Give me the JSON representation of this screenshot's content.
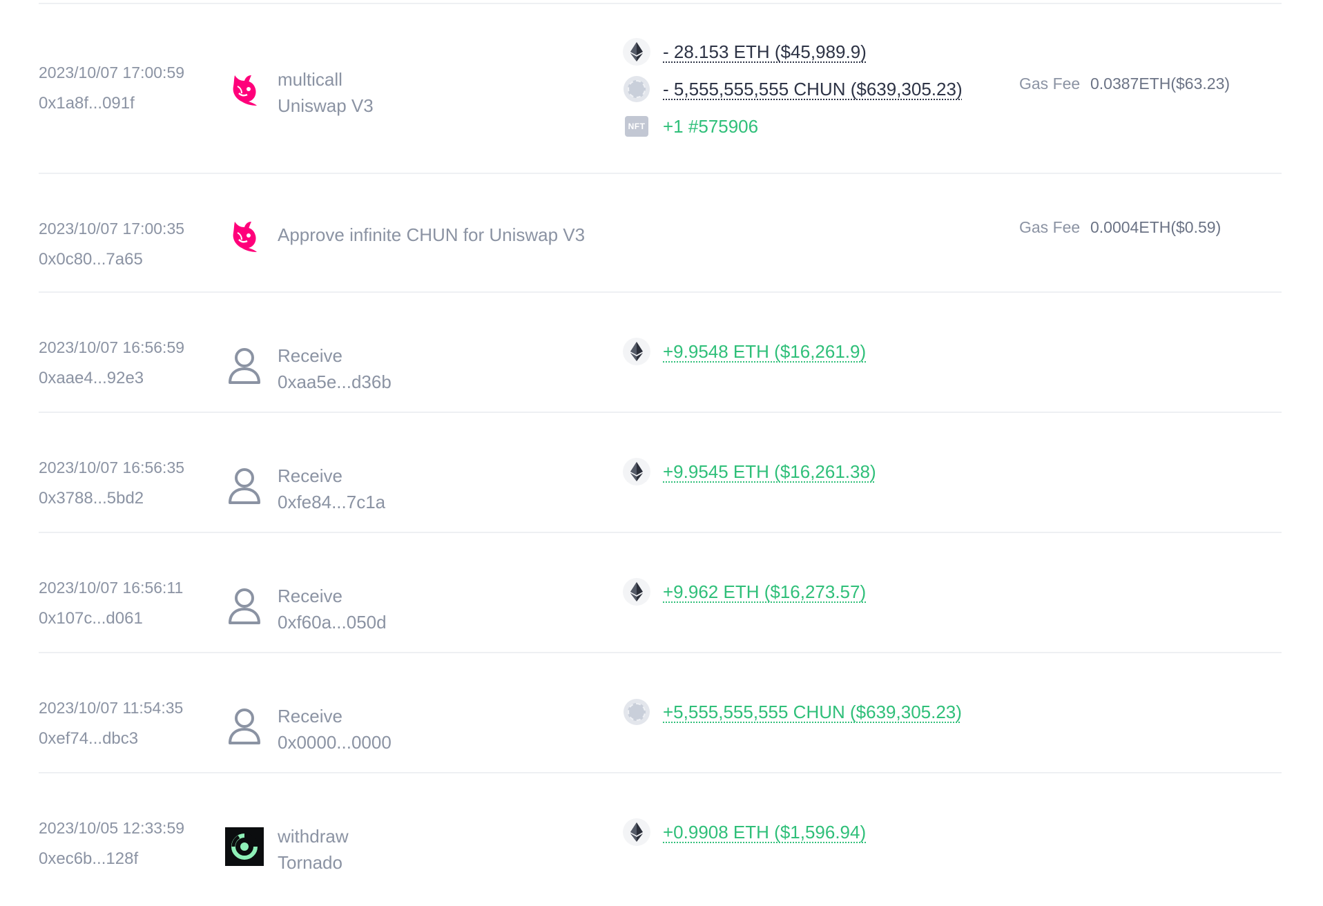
{
  "transactions": [
    {
      "time": "2023/10/07 17:00:59",
      "hash": "0x1a8f...091f",
      "project_icon": "uniswap-icon",
      "project_lines": [
        "multicall",
        "Uniswap V3"
      ],
      "tokens": [
        {
          "icon": "eth-icon",
          "text": "- 28.153 ETH ($45,989.9)",
          "direction": "out"
        },
        {
          "icon": "chun-icon",
          "text": "- 5,555,555,555 CHUN ($639,305.23)",
          "direction": "out"
        },
        {
          "icon": "nft-icon",
          "icon_text": "NFT",
          "text": "+1 #575906",
          "direction": "in-plain"
        }
      ],
      "gas_label": "Gas Fee",
      "gas_value": "0.0387ETH($63.23)"
    },
    {
      "time": "2023/10/07 17:00:35",
      "hash": "0x0c80...7a65",
      "project_icon": "uniswap-icon",
      "project_lines": [
        "Approve infinite CHUN for Uniswap V3"
      ],
      "tokens": [],
      "gas_label": "Gas Fee",
      "gas_value": "0.0004ETH($0.59)"
    },
    {
      "time": "2023/10/07 16:56:59",
      "hash": "0xaae4...92e3",
      "project_icon": "user-icon",
      "project_lines": [
        "Receive",
        "0xaa5e...d36b"
      ],
      "tokens": [
        {
          "icon": "eth-icon",
          "text": "+9.9548 ETH ($16,261.9)",
          "direction": "in"
        }
      ]
    },
    {
      "time": "2023/10/07 16:56:35",
      "hash": "0x3788...5bd2",
      "project_icon": "user-icon",
      "project_lines": [
        "Receive",
        "0xfe84...7c1a"
      ],
      "tokens": [
        {
          "icon": "eth-icon",
          "text": "+9.9545 ETH ($16,261.38)",
          "direction": "in"
        }
      ]
    },
    {
      "time": "2023/10/07 16:56:11",
      "hash": "0x107c...d061",
      "project_icon": "user-icon",
      "project_lines": [
        "Receive",
        "0xf60a...050d"
      ],
      "tokens": [
        {
          "icon": "eth-icon",
          "text": "+9.962 ETH ($16,273.57)",
          "direction": "in"
        }
      ]
    },
    {
      "time": "2023/10/07 11:54:35",
      "hash": "0xef74...dbc3",
      "project_icon": "user-icon",
      "project_lines": [
        "Receive",
        "0x0000...0000"
      ],
      "tokens": [
        {
          "icon": "chun-icon",
          "text": "+5,555,555,555 CHUN ($639,305.23)",
          "direction": "in"
        }
      ]
    },
    {
      "time": "2023/10/05 12:33:59",
      "hash": "0xec6b...128f",
      "project_icon": "tornado-icon",
      "project_lines": [
        "withdraw",
        "Tornado"
      ],
      "tokens": [
        {
          "icon": "eth-icon",
          "text": "+0.9908 ETH ($1,596.94)",
          "direction": "in"
        }
      ]
    }
  ],
  "colors": {
    "outgoing": "#2d3345",
    "incoming": "#2fbf79",
    "muted": "#8b93a3",
    "uniswap": "#ff007a",
    "divider": "#eef0f3"
  }
}
